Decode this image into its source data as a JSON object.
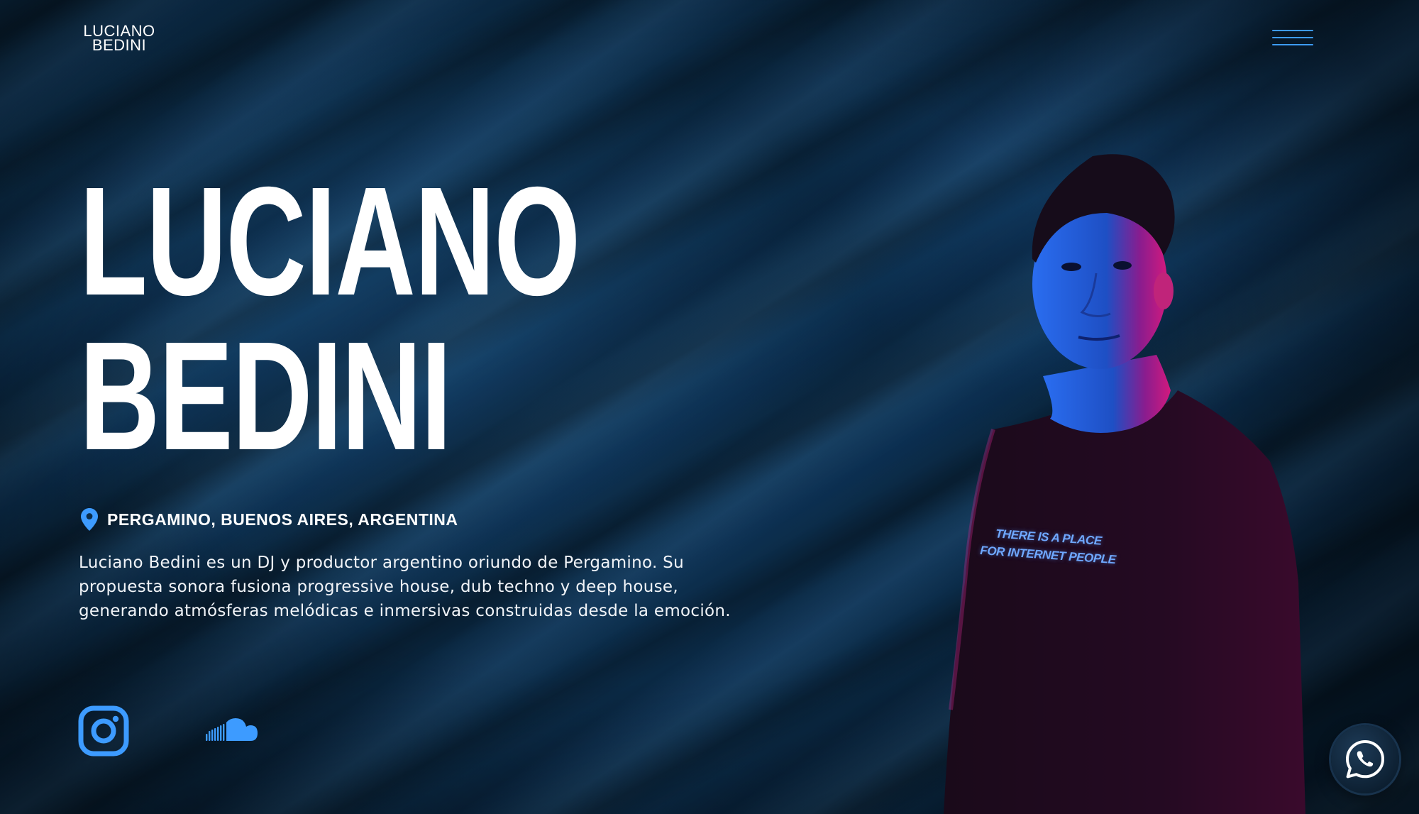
{
  "header": {
    "logo_line1": "LUCIANO",
    "logo_line2": "BEDINI",
    "menu_icon": "hamburger-icon"
  },
  "hero": {
    "title_line1": "LUCIANO",
    "title_line2": "BEDINI",
    "location_icon": "map-pin-icon",
    "location": "PERGAMINO, BUENOS AIRES, ARGENTINA",
    "bio": "Luciano Bedini es un DJ y productor argentino oriundo de Pergamino. Su propuesta sonora fusiona progressive house, dub techno y deep house, generando atmósferas melódicas e inmersivas construidas desde la emoción."
  },
  "social": [
    {
      "icon": "instagram-icon"
    },
    {
      "icon": "soundcloud-icon"
    }
  ],
  "portrait": {
    "shirt_line1": "THERE IS A PLACE",
    "shirt_line2": "FOR INTERNET PEOPLE"
  },
  "floating": {
    "icon": "whatsapp-icon"
  },
  "colors": {
    "accent": "#3d9bff",
    "text": "#ffffff",
    "background": "#0b2a44",
    "magenta_light": "#e0198c"
  }
}
